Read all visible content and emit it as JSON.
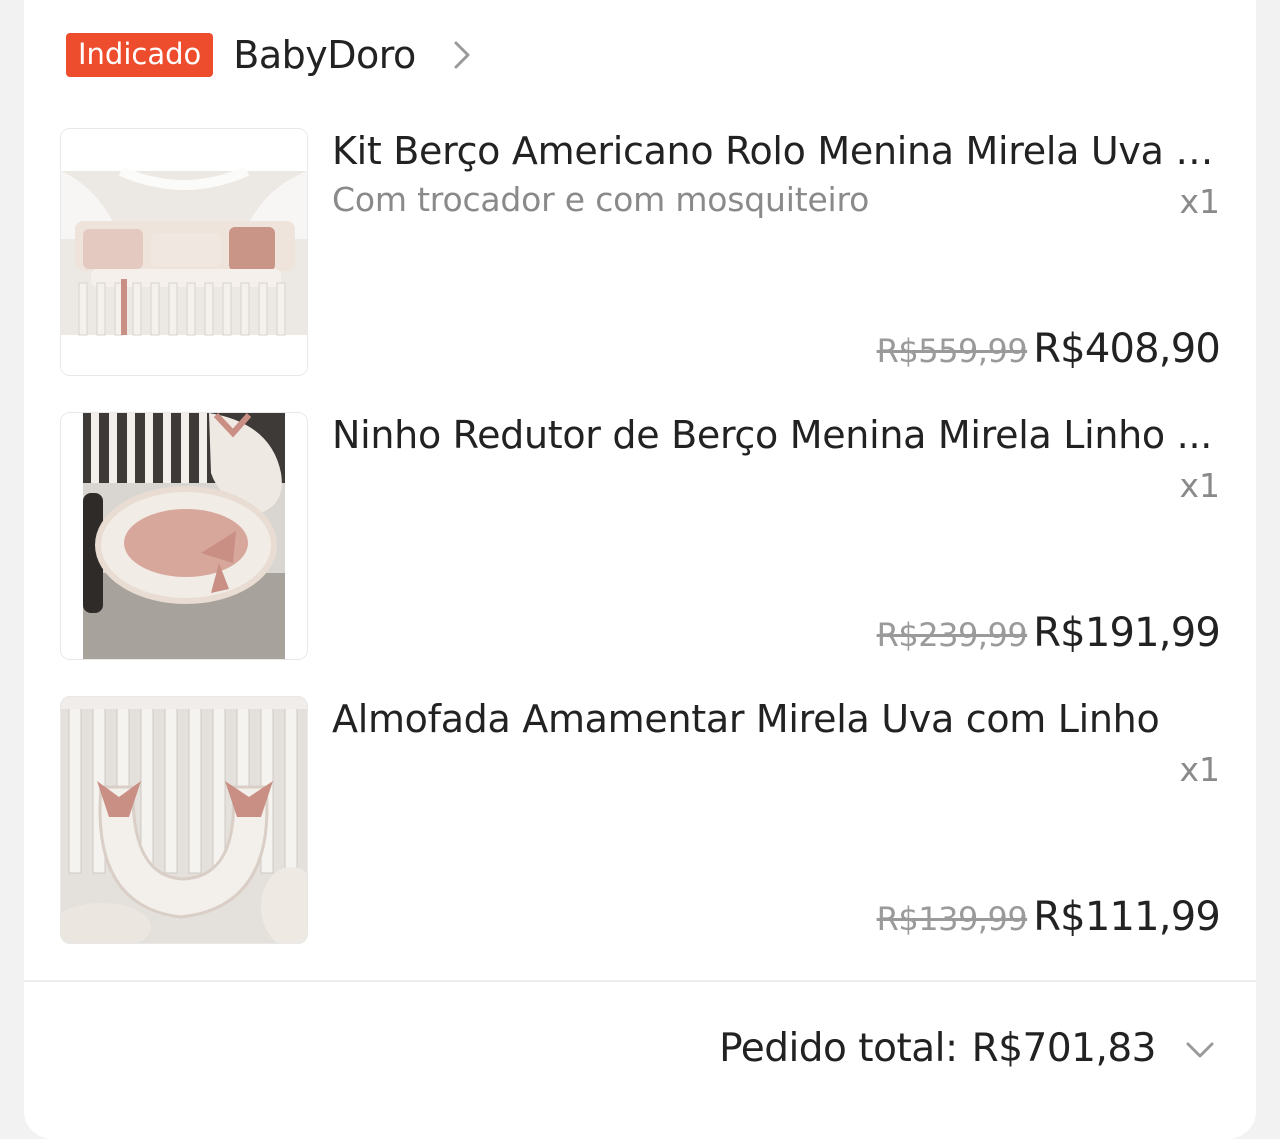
{
  "shop": {
    "badge": "Indicado",
    "name": "BabyDoro",
    "chevron_icon": "chevron-right-icon"
  },
  "items": [
    {
      "title": "Kit Berço Americano Rolo Menina Mirela Uva c...",
      "variant": "Com trocador e com mosquiteiro",
      "qty": "x1",
      "old_price": "R$559,99",
      "price": "R$408,90",
      "image": "crib-kit-photo"
    },
    {
      "title": "Ninho Redutor de Berço Menina Mirela Linho ...",
      "variant": "",
      "qty": "x1",
      "old_price": "R$239,99",
      "price": "R$191,99",
      "image": "baby-nest-photo"
    },
    {
      "title": "Almofada Amamentar Mirela Uva com Linho",
      "variant": "",
      "qty": "x1",
      "old_price": "R$139,99",
      "price": "R$111,99",
      "image": "nursing-pillow-photo"
    }
  ],
  "order_total": {
    "label": "Pedido total:",
    "value": "R$701,83",
    "chevron_icon": "chevron-down-icon"
  },
  "colors": {
    "badge_bg": "#ee4d2d",
    "text_primary": "#222222",
    "text_secondary": "#8a8a8a",
    "strikethrough": "#9a9a9a"
  }
}
